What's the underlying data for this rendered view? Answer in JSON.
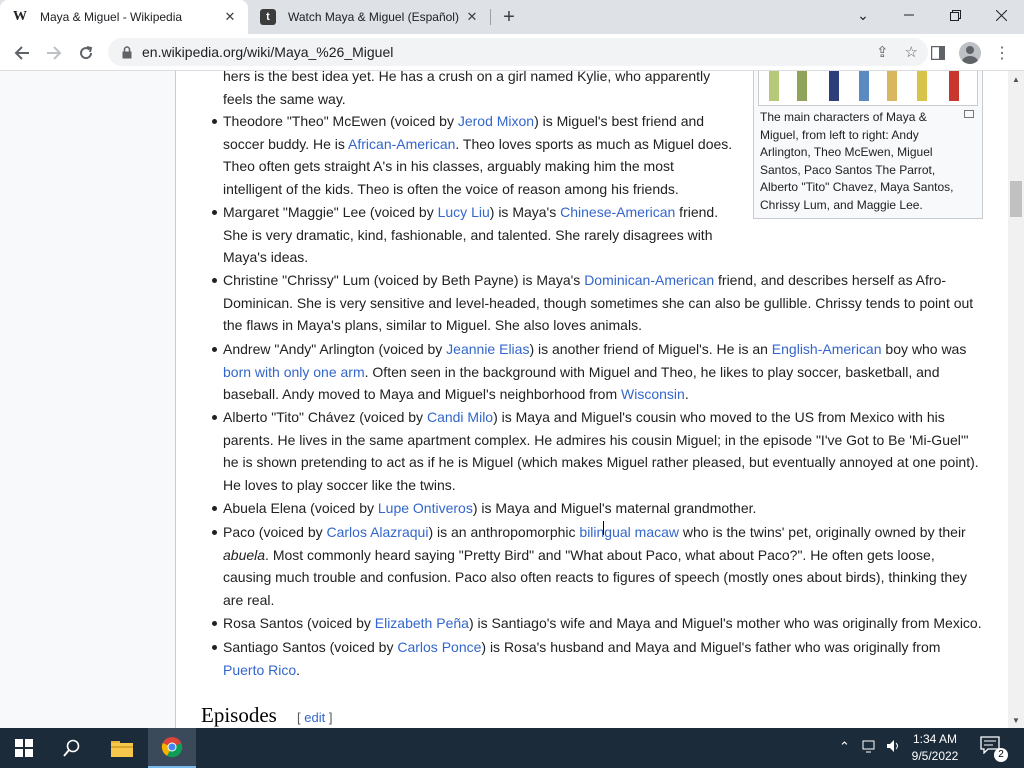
{
  "browser": {
    "tabs": [
      {
        "favicon": "W",
        "title": "Maya & Miguel - Wikipedia"
      },
      {
        "favicon": "t",
        "title": "Watch Maya & Miguel (Español)"
      }
    ],
    "url": "en.wikipedia.org/wiki/Maya_%26_Miguel"
  },
  "article": {
    "thumb_caption": "The main characters of Maya & Miguel, from left to right: Andy Arlington, Theo McEwen, Miguel Santos, Paco Santos The Parrot, Alberto \"Tito\" Chavez, Maya Santos, Chrissy Lum, and Maggie Lee.",
    "top_fragment": {
      "l1": "hers is the best idea yet. He has a crush on a girl named Kylie, who apparently",
      "l2": "feels the same way."
    },
    "theo": {
      "a": "Theodore \"Theo\" McEwen (voiced by ",
      "link1": "Jerod Mixon",
      "b": ") is Miguel's best friend and",
      "c": "soccer buddy. He is ",
      "link2": "African-American",
      "d": ". Theo loves sports as much as Miguel does.",
      "e": "Theo often gets straight A's in his classes, arguably making him the most",
      "f": "intelligent of the kids. Theo is often the voice of reason among his friends."
    },
    "maggie": {
      "a": "Margaret \"Maggie\" Lee (voiced by ",
      "link1": "Lucy Liu",
      "b": ") is Maya's ",
      "link2": "Chinese-American",
      "c": " friend.",
      "d": "She is very dramatic, kind, fashionable, and talented. She rarely disagrees with",
      "e": "Maya's ideas."
    },
    "chrissy": {
      "a": "Christine \"Chrissy\" Lum (voiced by Beth Payne) is Maya's ",
      "link1": "Dominican-American",
      "b": " friend, and describes herself as Afro-",
      "c": "Dominican. She is very sensitive and level-headed, though sometimes she can also be gullible. Chrissy tends to point out",
      "d": "the flaws in Maya's plans, similar to Miguel. She also loves animals."
    },
    "andy": {
      "a": "Andrew \"Andy\" Arlington (voiced by ",
      "link1": "Jeannie Elias",
      "b": ") is another friend of Miguel's. He is an ",
      "link2": "English-American",
      "c": " boy who was",
      "link3": "born with only one arm",
      "d": ". Often seen in the background with Miguel and Theo, he likes to play soccer, basketball, and",
      "e": "baseball. Andy moved to Maya and Miguel's neighborhood from ",
      "link4": "Wisconsin",
      "f": "."
    },
    "tito": {
      "a": "Alberto \"Tito\" Chávez (voiced by ",
      "link1": "Candi Milo",
      "b": ") is Maya and Miguel's cousin who moved to the US from Mexico with his",
      "c": "parents. He lives in the same apartment complex. He admires his cousin Miguel; in the episode \"I've Got to Be 'Mi-Guel'\"",
      "d": "he is shown pretending to act as if he is Miguel (which makes Miguel rather pleased, but eventually annoyed at one point).",
      "e": "He loves to play soccer like the twins."
    },
    "abuela": {
      "a": "Abuela Elena (voiced by ",
      "link1": "Lupe Ontiveros",
      "b": ") is Maya and Miguel's maternal grandmother."
    },
    "paco": {
      "a": "Paco (voiced by ",
      "link1": "Carlos Alazraqui",
      "b": ") is an anthropomorphic ",
      "link2": "bilingual macaw",
      "c": " who is the twins' pet, originally owned by their",
      "d_em": "abuela",
      "d": ". Most commonly heard saying \"Pretty Bird\" and \"What about Paco, what about Paco?\". He often gets loose,",
      "e": "causing much trouble and confusion. Paco also often reacts to figures of speech (mostly ones about birds), thinking they",
      "f": "are real."
    },
    "rosa": {
      "a": "Rosa Santos (voiced by ",
      "link1": "Elizabeth Peña",
      "b": ") is Santiago's wife and Maya and Miguel's mother who was originally from Mexico."
    },
    "santiago": {
      "a": "Santiago Santos (voiced by ",
      "link1": "Carlos Ponce",
      "b": ") is Rosa's husband and Maya and Miguel's father who was originally from",
      "link2": "Puerto Rico",
      "c": "."
    },
    "episodes_heading": "Episodes",
    "edit_open": "[ ",
    "edit_label": "edit",
    "edit_close": " ]"
  },
  "taskbar": {
    "time": "1:34 AM",
    "date": "9/5/2022",
    "notification_count": "2"
  }
}
